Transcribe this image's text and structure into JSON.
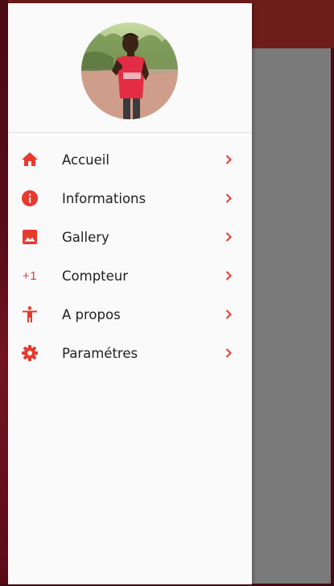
{
  "colors": {
    "accent": "#e8392f",
    "drawer_background": "#fafafa",
    "scrim": "#6b6b6b",
    "app_bar": "#6e1d1a"
  },
  "header": {
    "avatar_icon": "profile-photo"
  },
  "menu": {
    "items": [
      {
        "label": "Accueil",
        "icon": "home-icon"
      },
      {
        "label": "Informations",
        "icon": "info-icon"
      },
      {
        "label": "Gallery",
        "icon": "image-icon"
      },
      {
        "label": "Compteur",
        "icon": "plus-one-icon",
        "icon_text": "+1"
      },
      {
        "label": "A propos",
        "icon": "accessibility-icon"
      },
      {
        "label": "Paramétres",
        "icon": "settings-icon"
      }
    ]
  }
}
